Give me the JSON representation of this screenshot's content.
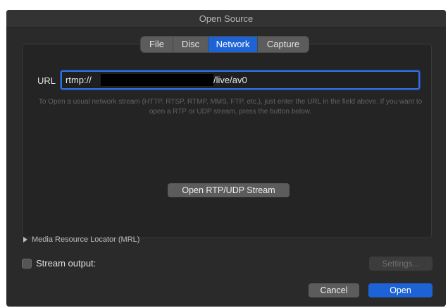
{
  "window": {
    "title": "Open Source"
  },
  "tabs": [
    {
      "label": "File",
      "active": false
    },
    {
      "label": "Disc",
      "active": false
    },
    {
      "label": "Network",
      "active": true
    },
    {
      "label": "Capture",
      "active": false
    }
  ],
  "url": {
    "label": "URL",
    "value_prefix": "rtmp://",
    "value_suffix": "/live/av0",
    "redacted": true
  },
  "help_text": "To Open a usual network stream (HTTP, RTSP, RTMP, MMS, FTP, etc.), just enter the URL in the field above. If you want to open a RTP or UDP stream, press the button below.",
  "rtp_button": {
    "label": "Open RTP/UDP Stream"
  },
  "mrl": {
    "label": "Media Resource Locator (MRL)",
    "expanded": false
  },
  "stream_output": {
    "label": "Stream output:",
    "checked": false
  },
  "settings_button": {
    "label": "Settings...",
    "enabled": false
  },
  "footer": {
    "cancel_label": "Cancel",
    "open_label": "Open"
  },
  "colors": {
    "accent": "#1e63d6",
    "window_bg": "#2a2a2a",
    "panel_bg": "#242424"
  }
}
